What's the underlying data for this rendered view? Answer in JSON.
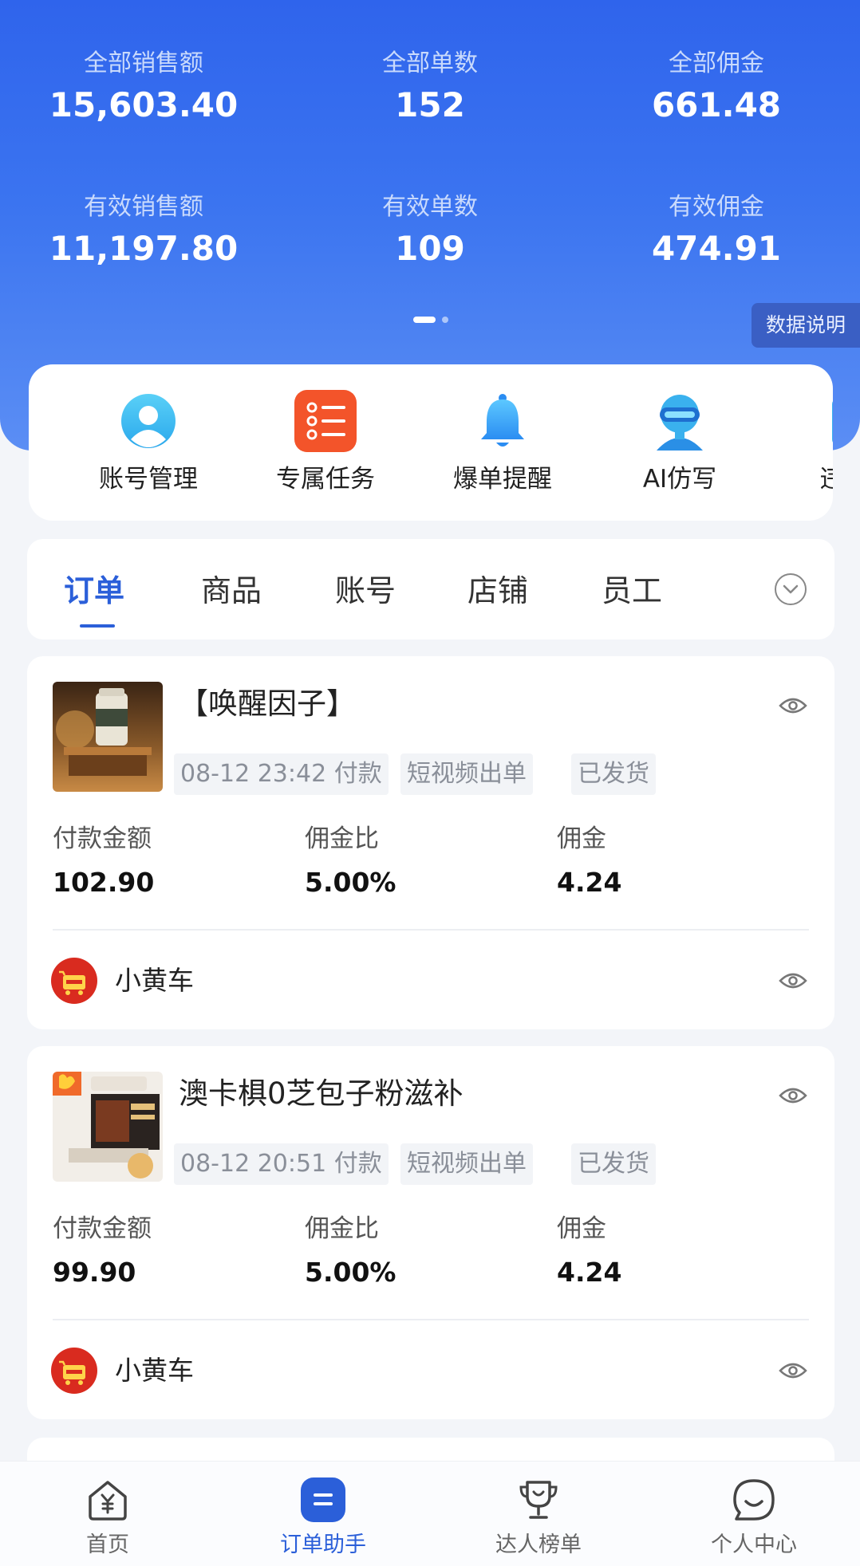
{
  "stats": {
    "total_sales": {
      "label": "全部销售额",
      "value": "15,603.40"
    },
    "total_orders": {
      "label": "全部单数",
      "value": "152"
    },
    "total_commission": {
      "label": "全部佣金",
      "value": "661.48"
    },
    "valid_sales": {
      "label": "有效销售额",
      "value": "11,197.80"
    },
    "valid_orders": {
      "label": "有效单数",
      "value": "109"
    },
    "valid_commission": {
      "label": "有效佣金",
      "value": "474.91"
    }
  },
  "data_note": "数据说明",
  "quick_actions": [
    {
      "label": "账号管理",
      "icon": "user-icon"
    },
    {
      "label": "专属任务",
      "icon": "task-list-icon"
    },
    {
      "label": "爆单提醒",
      "icon": "bell-icon"
    },
    {
      "label": "AI仿写",
      "icon": "ai-robot-icon"
    },
    {
      "label": "违禁词",
      "icon": "document-icon"
    }
  ],
  "tabs": [
    "订单",
    "商品",
    "账号",
    "店铺",
    "员工"
  ],
  "orders": [
    {
      "title": "【唤醒因子】",
      "time": "08-12 23:42 付款",
      "channel": "短视频出单",
      "status": "已发货",
      "pay_label": "付款金额",
      "pay_value": "102.90",
      "rate_label": "佣金比",
      "rate_value": "5.00%",
      "commission_label": "佣金",
      "commission_value": "4.24",
      "shop": "小黄车"
    },
    {
      "title": "澳卡椇0芝包子粉滋补",
      "time": "08-12 20:51 付款",
      "channel": "短视频出单",
      "status": "已发货",
      "pay_label": "付款金额",
      "pay_value": "99.90",
      "rate_label": "佣金比",
      "rate_value": "5.00%",
      "commission_label": "佣金",
      "commission_value": "4.24",
      "shop": "小黄车"
    }
  ],
  "bottom_nav": [
    {
      "label": "首页",
      "icon": "home-yuan-icon"
    },
    {
      "label": "订单助手",
      "icon": "order-assistant-icon",
      "active": true
    },
    {
      "label": "达人榜单",
      "icon": "trophy-icon"
    },
    {
      "label": "个人中心",
      "icon": "chat-smile-icon"
    }
  ],
  "colors": {
    "accent": "#2b5fd9",
    "hero_top": "#2f64ec",
    "hero_bottom": "#5b8ef4"
  }
}
